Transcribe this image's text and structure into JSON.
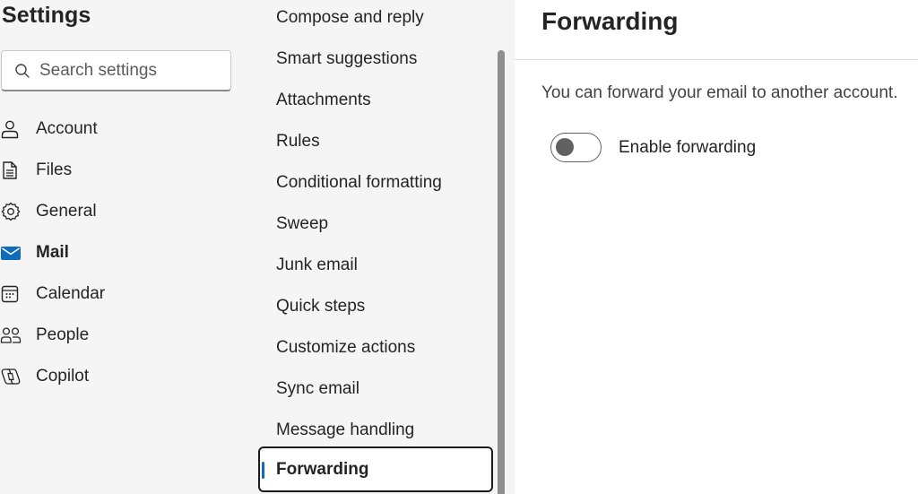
{
  "sidebar": {
    "title": "Settings",
    "search_placeholder": "Search settings",
    "items": [
      {
        "label": "Account",
        "icon": "person-icon"
      },
      {
        "label": "Files",
        "icon": "document-icon"
      },
      {
        "label": "General",
        "icon": "gear-icon"
      },
      {
        "label": "Mail",
        "icon": "mail-icon",
        "active": true
      },
      {
        "label": "Calendar",
        "icon": "calendar-icon"
      },
      {
        "label": "People",
        "icon": "people-icon"
      },
      {
        "label": "Copilot",
        "icon": "copilot-icon"
      }
    ]
  },
  "mail_menu": {
    "items": [
      {
        "label": "Compose and reply"
      },
      {
        "label": "Smart suggestions"
      },
      {
        "label": "Attachments"
      },
      {
        "label": "Rules"
      },
      {
        "label": "Conditional formatting"
      },
      {
        "label": "Sweep"
      },
      {
        "label": "Junk email"
      },
      {
        "label": "Quick steps"
      },
      {
        "label": "Customize actions"
      },
      {
        "label": "Sync email"
      },
      {
        "label": "Message handling"
      },
      {
        "label": "Forwarding",
        "active": true
      }
    ]
  },
  "content": {
    "title": "Forwarding",
    "description": "You can forward your email to another account.",
    "toggle_label": "Enable forwarding",
    "forwarding_enabled": false
  },
  "colors": {
    "accent": "#0f6cbd",
    "panel_bg": "#f5f5f5",
    "text": "#242424"
  }
}
